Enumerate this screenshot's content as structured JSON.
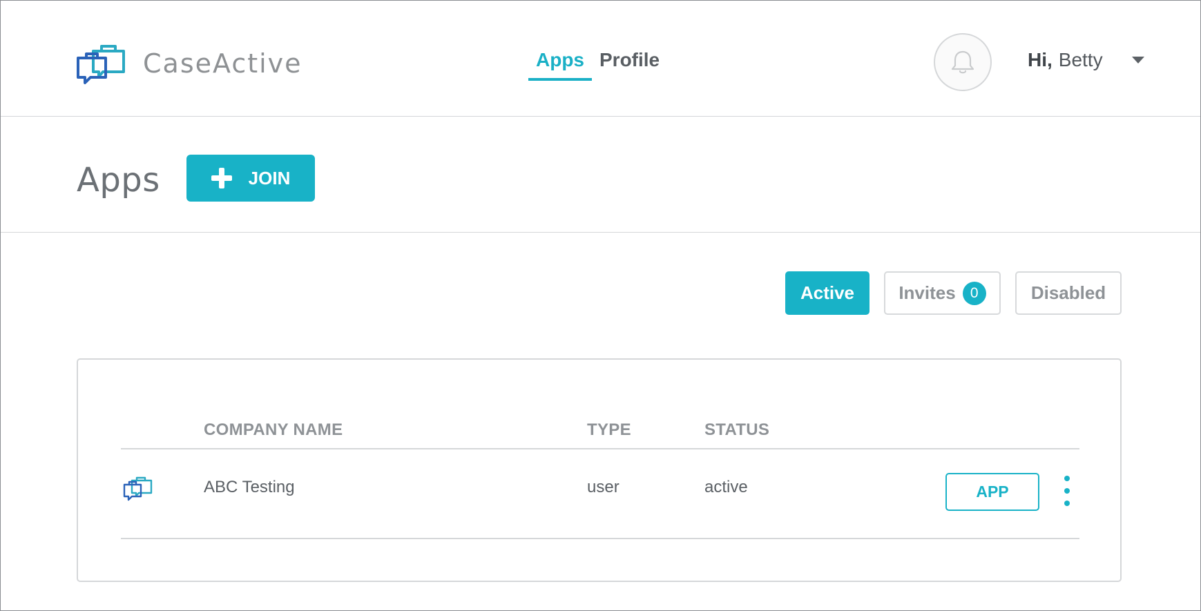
{
  "brand": {
    "name": "CaseActive",
    "accent_color": "#18b2c7",
    "logo_icon": "briefcase-chat-icon"
  },
  "nav": {
    "items": [
      {
        "label": "Apps",
        "active": true
      },
      {
        "label": "Profile",
        "active": false
      }
    ]
  },
  "header": {
    "notification_icon": "bell-icon",
    "greeting": "Hi,",
    "user_name": "Betty",
    "menu_icon": "caret-down-icon"
  },
  "page": {
    "title": "Apps",
    "join_label": "JOIN",
    "join_icon": "plus-icon"
  },
  "filters": {
    "active_label": "Active",
    "invites_label": "Invites",
    "invites_count": "0",
    "disabled_label": "Disabled",
    "selected": "Active"
  },
  "table": {
    "columns": [
      "COMPANY NAME",
      "TYPE",
      "STATUS"
    ],
    "rows": [
      {
        "icon": "briefcase-chat-icon",
        "company": "ABC Testing",
        "type": "user",
        "status": "active",
        "action_label": "APP",
        "more_icon": "kebab-menu-icon"
      }
    ]
  }
}
